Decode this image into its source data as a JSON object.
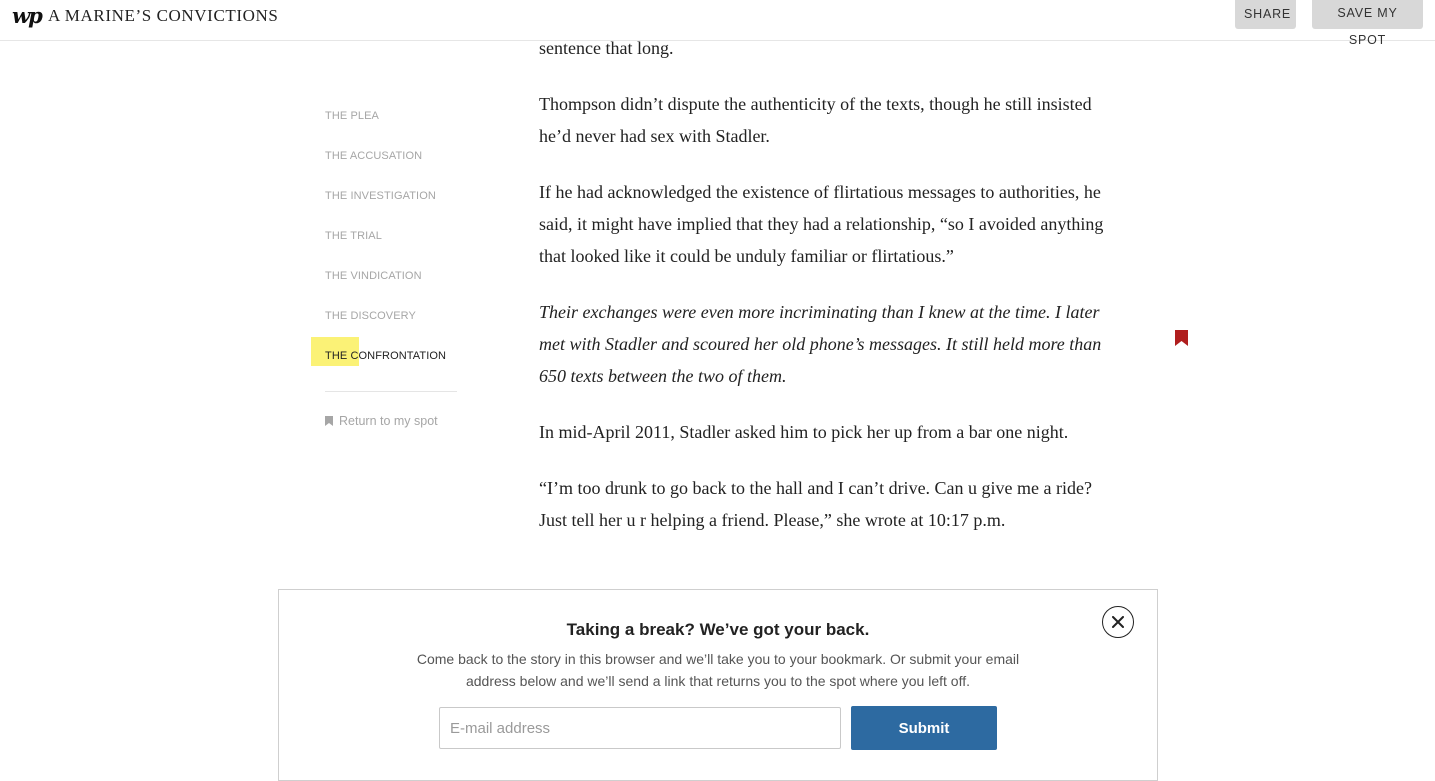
{
  "header": {
    "logo_text": "wp",
    "story_title": "A MARINE’S CONVICTIONS",
    "share_label": "SHARE",
    "save_label": "SAVE MY SPOT"
  },
  "sidebar": {
    "items": [
      {
        "label": "THE PLEA",
        "active": false
      },
      {
        "label": "THE ACCUSATION",
        "active": false
      },
      {
        "label": "THE INVESTIGATION",
        "active": false
      },
      {
        "label": "THE TRIAL",
        "active": false
      },
      {
        "label": "THE VINDICATION",
        "active": false
      },
      {
        "label": "THE DISCOVERY",
        "active": false
      },
      {
        "label": "THE CONFRONTATION",
        "active": true
      }
    ],
    "return_label": "Return to my spot"
  },
  "article": {
    "paragraphs": [
      {
        "text": "sentence that long.",
        "italic": false
      },
      {
        "text": "Thompson didn’t dispute the authenticity of the texts, though he still insisted he’d never had sex with Stadler.",
        "italic": false
      },
      {
        "text": "If he had acknowledged the existence of flirtatious messages to authorities, he said, it might have implied that they had a relationship, “so I avoided anything that looked like it could be unduly familiar or flirtatious.”",
        "italic": false
      },
      {
        "text": "Their exchanges were even more incriminating than I knew at the time. I later met with Stadler and scoured her old phone’s messages. It still held more than 650 texts between the two of them.",
        "italic": true
      },
      {
        "text": "In mid-April 2011, Stadler asked him to pick her up from a bar one night.",
        "italic": false
      },
      {
        "text": "“I’m too drunk to go back to the hall and I can’t drive. Can u give me a ride? Just tell her u r helping a friend. Please,” she wrote at 10:17 p.m.",
        "italic": false
      }
    ]
  },
  "modal": {
    "title": "Taking a break? We’ve got your back.",
    "body": "Come back to the story in this browser and we’ll take you to your bookmark. Or submit your email address below and we’ll send a link that returns you to the spot where you left off.",
    "email_placeholder": "E-mail address",
    "email_value": "",
    "submit_label": "Submit"
  },
  "colors": {
    "highlight": "#fbf276",
    "bookmark_red": "#b01e1e",
    "submit_blue": "#2d6aa1"
  }
}
